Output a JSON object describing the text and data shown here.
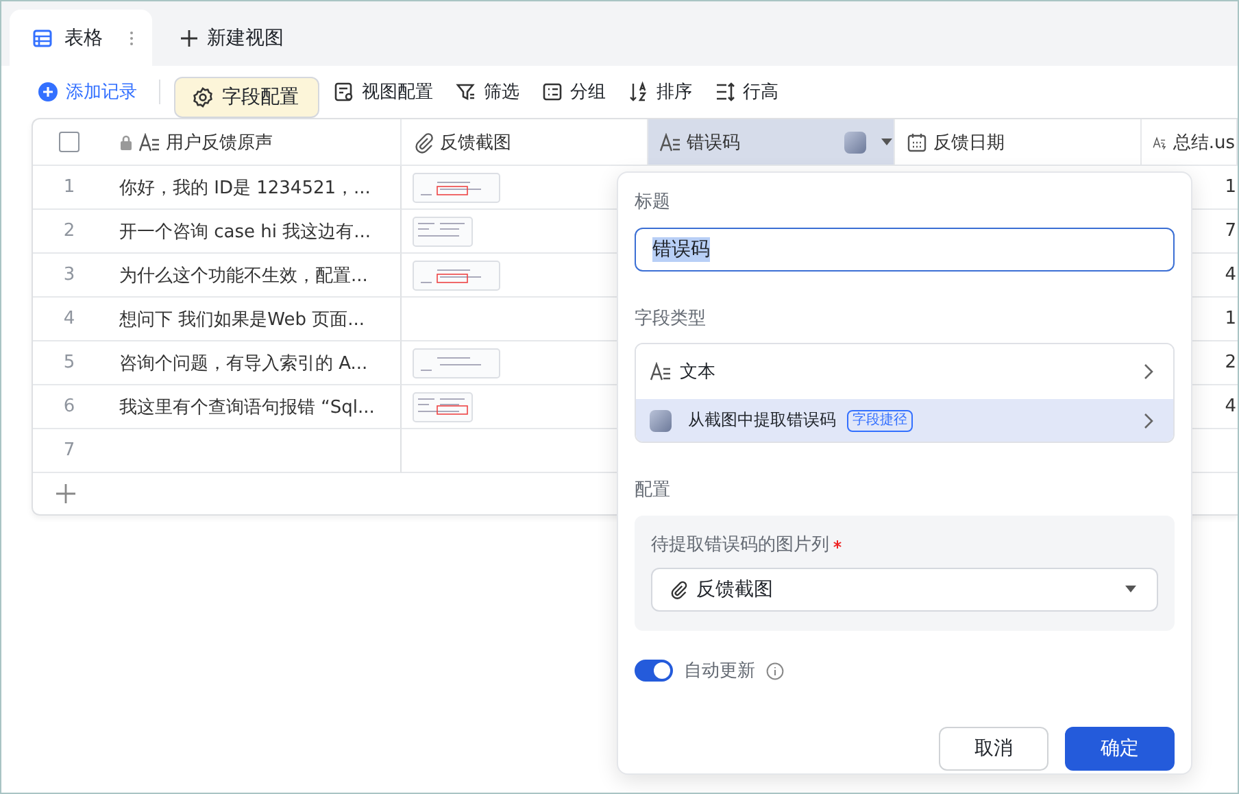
{
  "tabs": [
    {
      "label": "表格",
      "selected": true
    }
  ],
  "new_view": {
    "label": "新建视图"
  },
  "toolbar": [
    {
      "label": "添加记录",
      "kind": "add",
      "selected": false
    },
    {
      "label": "字段配置",
      "kind": "gear",
      "selected": true
    },
    {
      "label": "视图配置",
      "kind": "view",
      "selected": false
    },
    {
      "label": "筛选",
      "kind": "filter",
      "selected": false
    },
    {
      "label": "分组",
      "kind": "group",
      "selected": false
    },
    {
      "label": "排序",
      "kind": "sort",
      "selected": false
    },
    {
      "label": "行高",
      "kind": "height",
      "selected": false
    }
  ],
  "table": {
    "header_checkbox": {
      "checked": false
    },
    "columns": [
      {
        "label": "用户反馈原声",
        "kind": "text",
        "locked": true,
        "selected": false
      },
      {
        "label": "反馈截图",
        "kind": "attachment",
        "locked": false,
        "selected": false
      },
      {
        "label": "错误码",
        "kind": "text",
        "locked": false,
        "selected": true,
        "shortcut": true
      },
      {
        "label": "反馈日期",
        "kind": "date",
        "locked": false,
        "selected": false
      },
      {
        "label": "总结.us",
        "kind": "ai",
        "locked": false,
        "selected": false
      }
    ],
    "rows": [
      {
        "index": "1",
        "feedback": "你好，我的 ID是 1234521，...",
        "screenshot": true,
        "column_5": "1"
      },
      {
        "index": "2",
        "feedback": "开一个咨询 case hi 我这边有...",
        "screenshot": true,
        "column_5": "7"
      },
      {
        "index": "3",
        "feedback": "为什么这个功能不生效，配置...",
        "screenshot": true,
        "column_5": "4"
      },
      {
        "index": "4",
        "feedback": "想问下 我们如果是Web 页面...",
        "screenshot": false,
        "column_5": "1"
      },
      {
        "index": "5",
        "feedback": "咨询个问题，有导入索引的 A...",
        "screenshot": true,
        "column_5": "2"
      },
      {
        "index": "6",
        "feedback": "我这里有个查询语句报错 “Sql...",
        "screenshot": true,
        "column_5": "4"
      },
      {
        "index": "7",
        "screenshot": false
      }
    ]
  },
  "field_panel": {
    "title_label": "标题",
    "title_value": "错误码",
    "type_label": "字段类型",
    "types": [
      {
        "label": "文本",
        "kind": "text",
        "selected": false
      },
      {
        "label": "从截图中提取错误码",
        "kind": "shortcut",
        "badge": "字段捷径",
        "selected": true
      }
    ],
    "config_label": "配置",
    "source_label": "待提取错误码的图片列",
    "required": true,
    "source_value": "反馈截图",
    "auto_update": {
      "label": "自动更新",
      "on": true
    },
    "buttons": [
      {
        "label": "取消",
        "kind": "secondary"
      },
      {
        "label": "确定",
        "kind": "primary"
      }
    ]
  }
}
